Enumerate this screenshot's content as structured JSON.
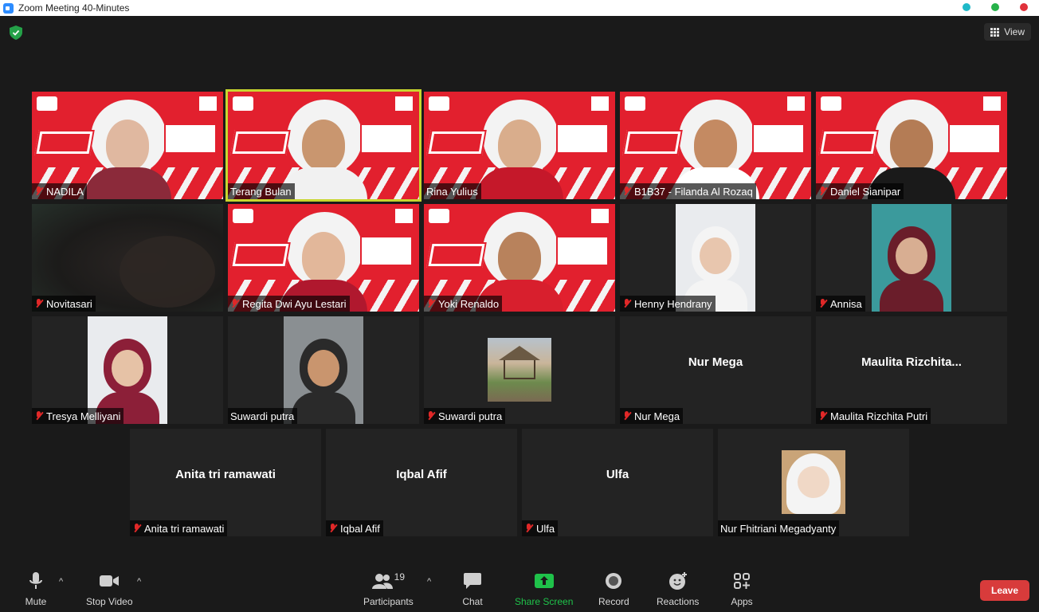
{
  "window": {
    "title": "Zoom Meeting 40-Minutes",
    "dots": [
      "#1fb9c8",
      "#27b24a",
      "#e0313b"
    ]
  },
  "header": {
    "view_label": "View"
  },
  "participants": [
    {
      "name": "NADILA",
      "muted": true,
      "video": "banner"
    },
    {
      "name": "Terang Bulan",
      "muted": false,
      "video": "banner",
      "active": true
    },
    {
      "name": "Rina Yulius",
      "muted": false,
      "video": "banner"
    },
    {
      "name": "B1B37 - Filanda Al Rozaq",
      "muted": true,
      "video": "banner"
    },
    {
      "name": "Daniel Sianipar",
      "muted": true,
      "video": "banner"
    },
    {
      "name": "Novitasari",
      "muted": true,
      "video": "camera"
    },
    {
      "name": "Regita Dwi Ayu Lestari",
      "muted": true,
      "video": "banner"
    },
    {
      "name": "Yoki Renaldo",
      "muted": true,
      "video": "banner"
    },
    {
      "name": "Henny Hendrany",
      "muted": true,
      "video": "portrait"
    },
    {
      "name": "Annisa",
      "muted": true,
      "video": "portrait"
    },
    {
      "name": "Tresya Melliyani",
      "muted": true,
      "video": "portrait"
    },
    {
      "name": "Suwardi putra",
      "muted": false,
      "video": "portrait"
    },
    {
      "name": "Suwardi putra",
      "muted": true,
      "video": "avatar"
    },
    {
      "name": "Nur Mega",
      "muted": true,
      "video": "off",
      "display": "Nur Mega"
    },
    {
      "name": "Maulita Rizchita Putri",
      "muted": true,
      "video": "off",
      "display": "Maulita  Rizchita..."
    },
    {
      "name": "Anita tri ramawati",
      "muted": true,
      "video": "off",
      "display": "Anita tri ramawati"
    },
    {
      "name": "Iqbal Afif",
      "muted": true,
      "video": "off",
      "display": "Iqbal Afif"
    },
    {
      "name": "Ulfa",
      "muted": true,
      "video": "off",
      "display": "Ulfa"
    },
    {
      "name": "Nur Fhitriani Megadyanty",
      "muted": false,
      "video": "avatar"
    }
  ],
  "toolbar": {
    "mute": "Mute",
    "stop_video": "Stop Video",
    "participants": "Participants",
    "participant_count": "19",
    "chat": "Chat",
    "share_screen": "Share Screen",
    "record": "Record",
    "reactions": "Reactions",
    "apps": "Apps",
    "leave": "Leave"
  }
}
